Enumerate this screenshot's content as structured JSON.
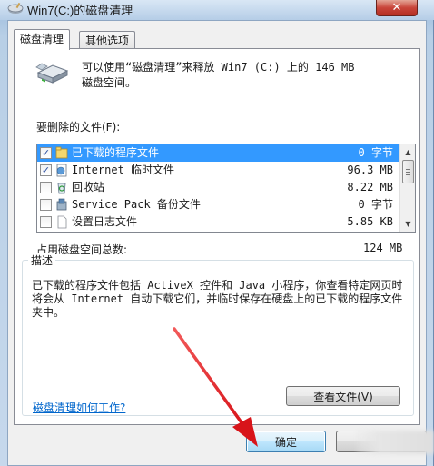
{
  "window": {
    "title": "Win7(C:)的磁盘清理",
    "close_label": "✕"
  },
  "tabs": [
    {
      "label": "磁盘清理",
      "active": true
    },
    {
      "label": "其他选项",
      "active": false
    }
  ],
  "info": {
    "line1": "可以使用“磁盘清理”来释放 Win7 (C:) 上的 146 MB",
    "line2": "磁盘空间。"
  },
  "files_to_delete_label": "要删除的文件(F):",
  "file_list": [
    {
      "name": "已下载的程序文件",
      "size": "0 字节",
      "checked": true,
      "selected": true,
      "icon": "folder-icon"
    },
    {
      "name": "Internet 临时文件",
      "size": "96.3 MB",
      "checked": true,
      "selected": false,
      "icon": "internet-files-icon"
    },
    {
      "name": "回收站",
      "size": "8.22 MB",
      "checked": false,
      "selected": false,
      "icon": "recycle-bin-icon"
    },
    {
      "name": "Service Pack 备份文件",
      "size": "0 字节",
      "checked": false,
      "selected": false,
      "icon": "service-pack-icon"
    },
    {
      "name": "设置日志文件",
      "size": "5.85 KB",
      "checked": false,
      "selected": false,
      "icon": "document-icon"
    }
  ],
  "total": {
    "label": "占用磁盘空间总数:",
    "value": "124 MB"
  },
  "description": {
    "title": "描述",
    "text": "已下载的程序文件包括 ActiveX 控件和 Java 小程序，你查看特定网页时将会从 Internet 自动下载它们，并临时保存在硬盘上的已下载的程序文件夹中。",
    "view_files_button": "查看文件(V)"
  },
  "help_link": "磁盘清理如何工作?",
  "buttons": {
    "ok": "确定"
  },
  "colors": {
    "selection": "#3399ff",
    "link": "#0066cc",
    "annotation_arrow": "#e8292b"
  }
}
